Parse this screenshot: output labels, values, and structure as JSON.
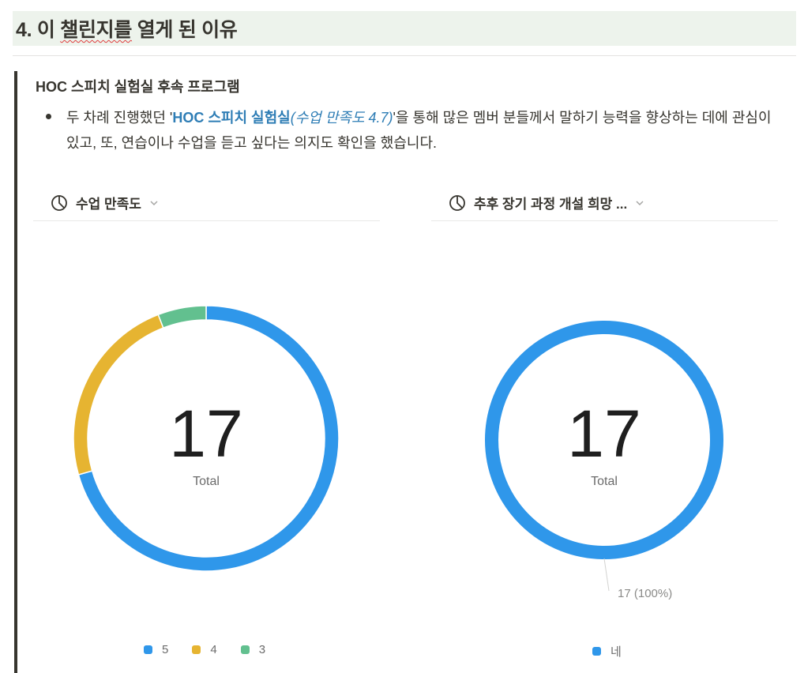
{
  "section": {
    "heading_prefix": "4. 이 ",
    "heading_underlined": "챌린지를",
    "heading_suffix": " 열게 된 이유"
  },
  "block": {
    "subtitle": "HOC 스피치 실험실 후속 프로그램",
    "bullet": {
      "before": "두 차례 진행했던 '",
      "link_bold": "HOC 스피치 실험실",
      "link_italic": "(수업 만족도 4.7)",
      "after": "'을 통해 많은 멤버 분들께서 말하기 능력을 향상하는 데에 관심이 있고, 또, 연습이나 수업을 듣고 싶다는 의지도 확인을 했습니다."
    }
  },
  "colors": {
    "blue": "#2f97ea",
    "yellow": "#e6b431",
    "green": "#62c08f",
    "accent_link": "#2e7db5"
  },
  "chart_data": [
    {
      "type": "pie",
      "title": "수업 만족도",
      "total": "17",
      "total_label": "Total",
      "categories": [
        "5",
        "4",
        "3"
      ],
      "values": [
        12,
        4,
        1
      ],
      "colors": [
        "#2f97ea",
        "#e6b431",
        "#62c08f"
      ],
      "icon": "pie-chart-icon",
      "legend_position": "bottom"
    },
    {
      "type": "pie",
      "title": "추후 장기 과정 개설 희망 ...",
      "total": "17",
      "total_label": "Total",
      "categories": [
        "네"
      ],
      "values": [
        17
      ],
      "colors": [
        "#2f97ea"
      ],
      "slice_label": "17 (100%)",
      "icon": "pie-chart-icon",
      "legend_position": "bottom"
    }
  ]
}
